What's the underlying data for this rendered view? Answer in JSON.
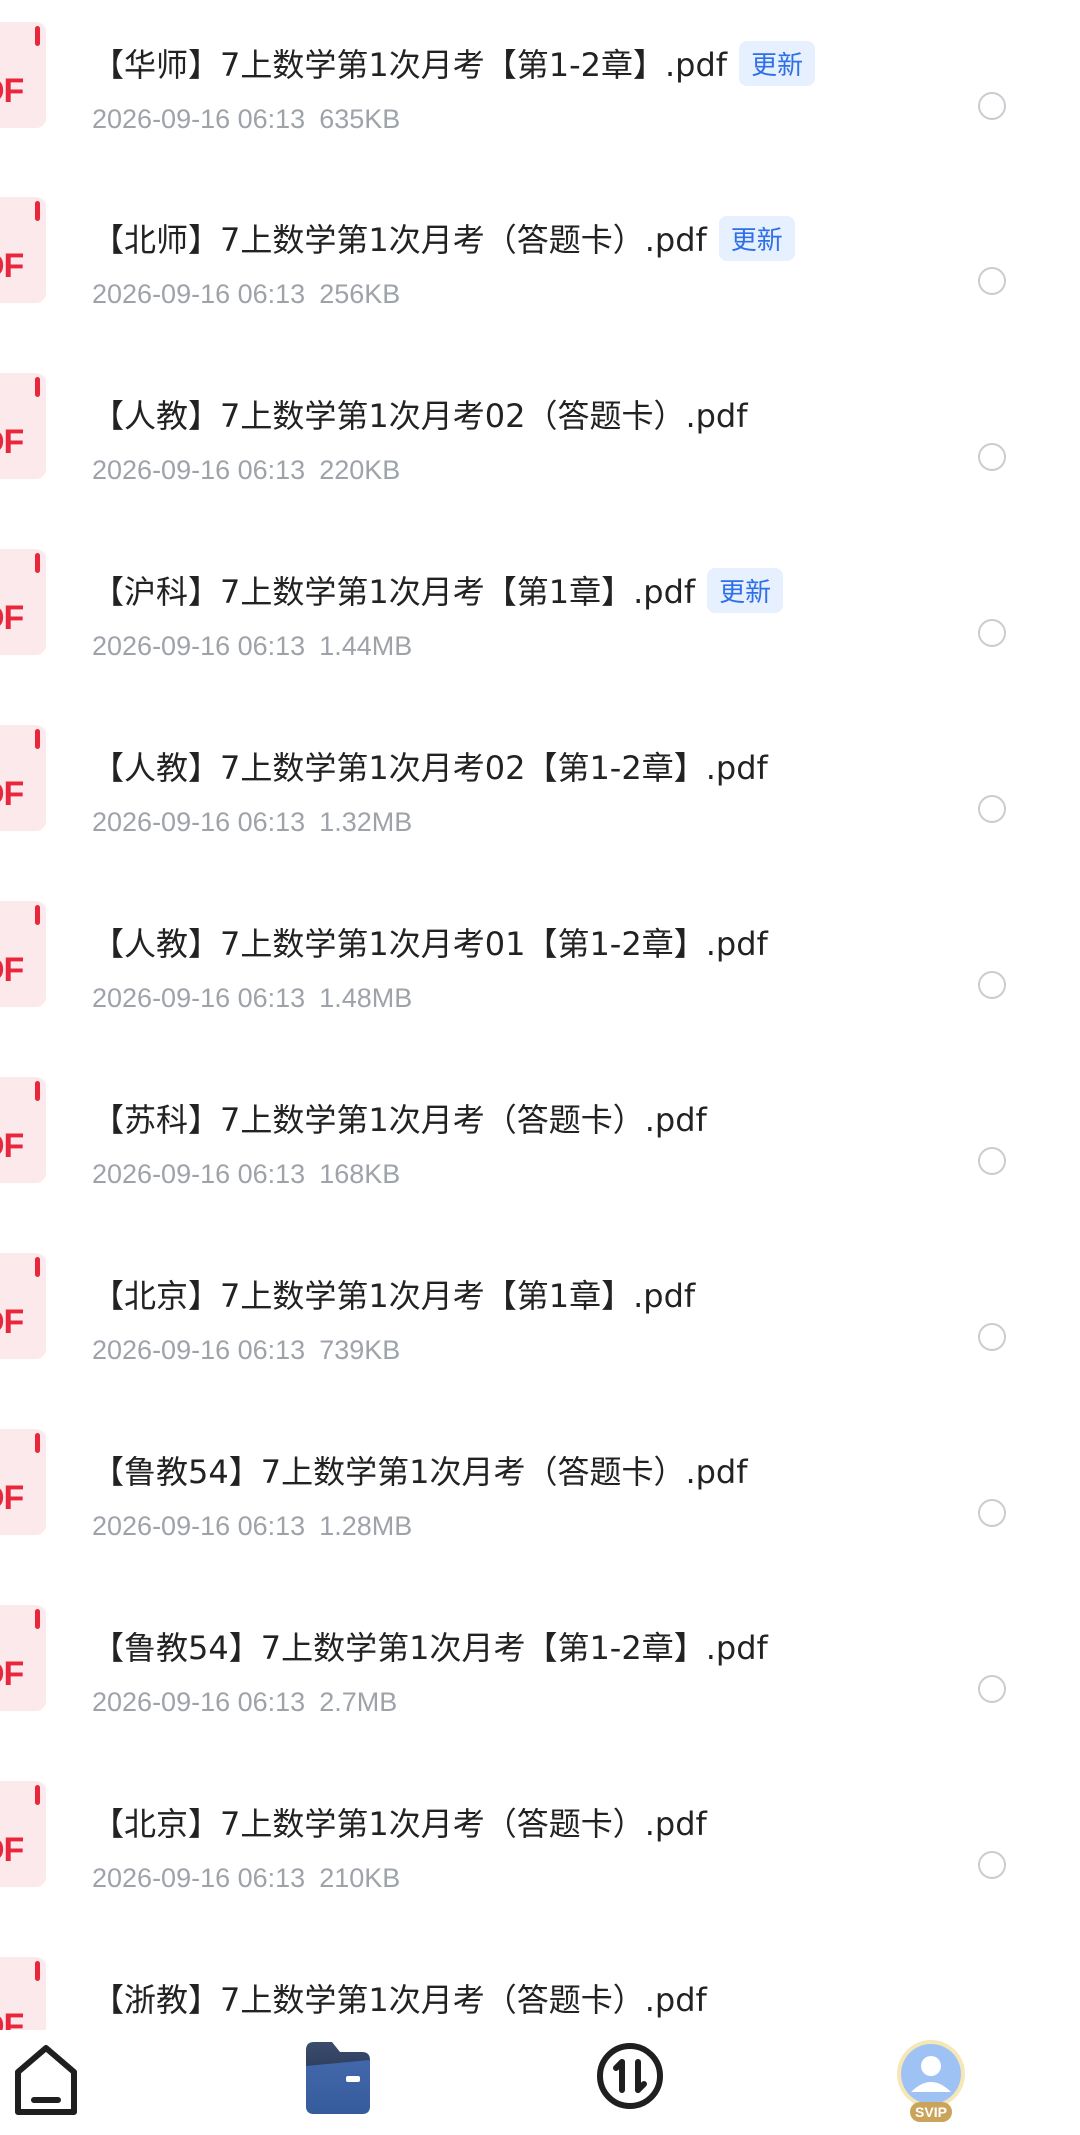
{
  "files": [
    {
      "title": "【华师】7上数学第1次月考【第1-2章】.pdf",
      "badge": "更新",
      "date": "2026-09-16 06:13",
      "size": "635KB"
    },
    {
      "title": "【北师】7上数学第1次月考（答题卡）.pdf",
      "badge": "更新",
      "date": "2026-09-16 06:13",
      "size": "256KB"
    },
    {
      "title": "【人教】7上数学第1次月考02（答题卡）.pdf",
      "badge": "",
      "date": "2026-09-16 06:13",
      "size": "220KB"
    },
    {
      "title": "【沪科】7上数学第1次月考【第1章】.pdf",
      "badge": "更新",
      "date": "2026-09-16 06:13",
      "size": "1.44MB"
    },
    {
      "title": "【人教】7上数学第1次月考02【第1-2章】.pdf",
      "badge": "",
      "date": "2026-09-16 06:13",
      "size": "1.32MB"
    },
    {
      "title": "【人教】7上数学第1次月考01【第1-2章】.pdf",
      "badge": "",
      "date": "2026-09-16 06:13",
      "size": "1.48MB"
    },
    {
      "title": "【苏科】7上数学第1次月考（答题卡）.pdf",
      "badge": "",
      "date": "2026-09-16 06:13",
      "size": "168KB"
    },
    {
      "title": "【北京】7上数学第1次月考【第1章】.pdf",
      "badge": "",
      "date": "2026-09-16 06:13",
      "size": "739KB"
    },
    {
      "title": "【鲁教54】7上数学第1次月考（答题卡）.pdf",
      "badge": "",
      "date": "2026-09-16 06:13",
      "size": "1.28MB"
    },
    {
      "title": "【鲁教54】7上数学第1次月考【第1-2章】.pdf",
      "badge": "",
      "date": "2026-09-16 06:13",
      "size": "2.7MB"
    },
    {
      "title": "【北京】7上数学第1次月考（答题卡）.pdf",
      "badge": "",
      "date": "2026-09-16 06:13",
      "size": "210KB"
    },
    {
      "title": "【浙教】7上数学第1次月考（答题卡）.pdf",
      "badge": "",
      "date": "",
      "size": ""
    }
  ],
  "file_icon_label": "DF",
  "nav": {
    "items": [
      {
        "icon": "home-icon"
      },
      {
        "icon": "folder-icon"
      },
      {
        "icon": "transfer-icon"
      },
      {
        "icon": "avatar-icon",
        "badge": "SVIP"
      }
    ]
  },
  "colors": {
    "accent": "#2f6fe8",
    "pdf_red": "#e8263c",
    "meta_gray": "#9ea3aa"
  }
}
